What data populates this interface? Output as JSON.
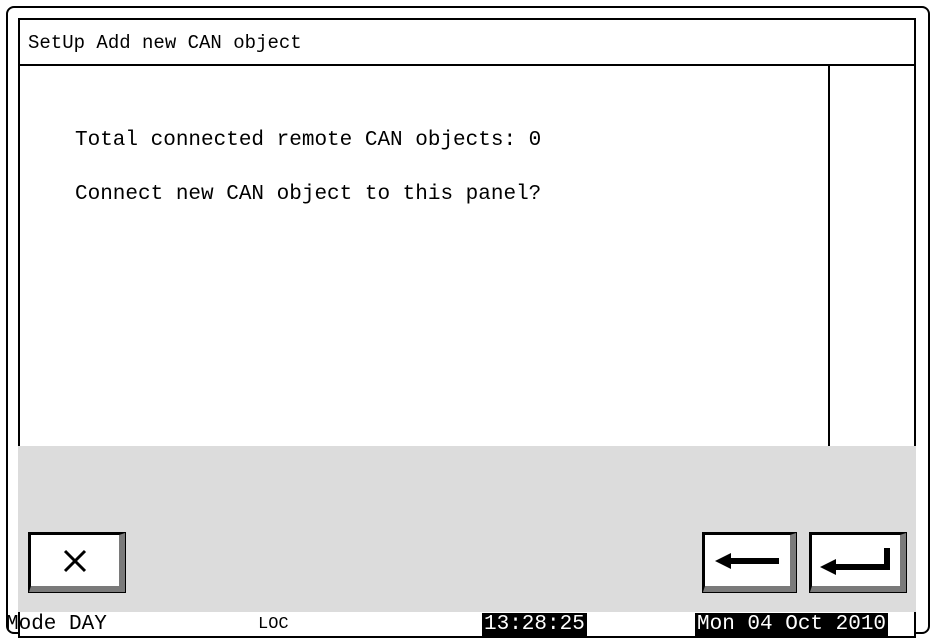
{
  "header": {
    "title": "SetUp Add new CAN object"
  },
  "main": {
    "line1": "Total connected remote CAN objects: 0",
    "line2": "Connect new CAN object to this panel?"
  },
  "buttons": {
    "close_icon": "close-x-icon",
    "back_icon": "left-arrow-icon",
    "enter_icon": "enter-return-icon"
  },
  "status": {
    "mode": "Mode DAY",
    "loc": "LOC",
    "time": "13:28:25",
    "date": "Mon 04 Oct 2010"
  }
}
